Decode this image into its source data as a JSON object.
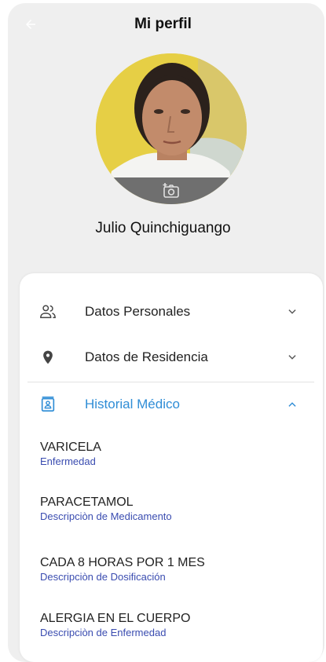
{
  "header": {
    "title": "Mi perfil",
    "back_icon": "arrow-left-icon"
  },
  "profile": {
    "name": "Julio Quinchiguango",
    "camera_icon": "add-photo-icon"
  },
  "sections": [
    {
      "label": "Datos Personales",
      "icon": "people-icon",
      "expanded": false
    },
    {
      "label": "Datos de Residencia",
      "icon": "location-pin-icon",
      "expanded": false
    },
    {
      "label": "Historial Médico",
      "icon": "medical-id-icon",
      "expanded": true
    }
  ],
  "history": [
    {
      "value": "VARICELA",
      "desc": "Enfermedad"
    },
    {
      "value": "PARACETAMOL",
      "desc": "Descripciòn de Medicamento"
    },
    {
      "value": "CADA 8 HORAS POR 1 MES",
      "desc": "Descripciòn de Dosificación"
    },
    {
      "value": "ALERGIA EN EL CUERPO",
      "desc": "Descripciòn de Enfermedad"
    }
  ],
  "colors": {
    "header_bg": "#efefef",
    "accent": "#2f8dd6",
    "description": "#3a4cb0",
    "avatar_bg": "#e8d34a"
  }
}
